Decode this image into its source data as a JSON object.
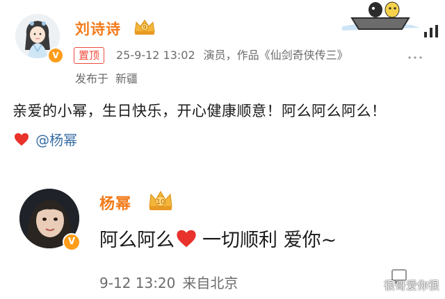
{
  "post": {
    "author": "刘诗诗",
    "pinned_label": "置顶",
    "timestamp": "25-9-12 13:02",
    "author_bio": "演员，作品《仙剑奇侠传三》",
    "more_label": "...",
    "location_prefix": "发布于",
    "location": "新疆",
    "text": "亲爱的小幂，生日快乐，开心健康顺意！阿么阿么阿么！",
    "mention": "@杨幂",
    "author_level_badge": "9"
  },
  "reply": {
    "author": "杨幂",
    "author_level_badge": "10",
    "text_part1": "阿么阿么",
    "text_part2": "一切顺利 爱你~",
    "timestamp": "9-12 13:20",
    "location": "来自北京"
  },
  "watermark": "很哥爱你很",
  "colors": {
    "name_orange": "#f27a1a",
    "pinned_red": "#f04a3b",
    "link_blue": "#3a6ea5",
    "verified_orange": "#ff9c1a",
    "heart_red": "#e8322b",
    "meta_gray": "#6b6b6b"
  },
  "icons": {
    "crown_badge": "crown-icon",
    "verified": "verified-v-icon",
    "heart": "heart-icon",
    "more": "more-dots-icon",
    "reply": "reply-icon"
  }
}
